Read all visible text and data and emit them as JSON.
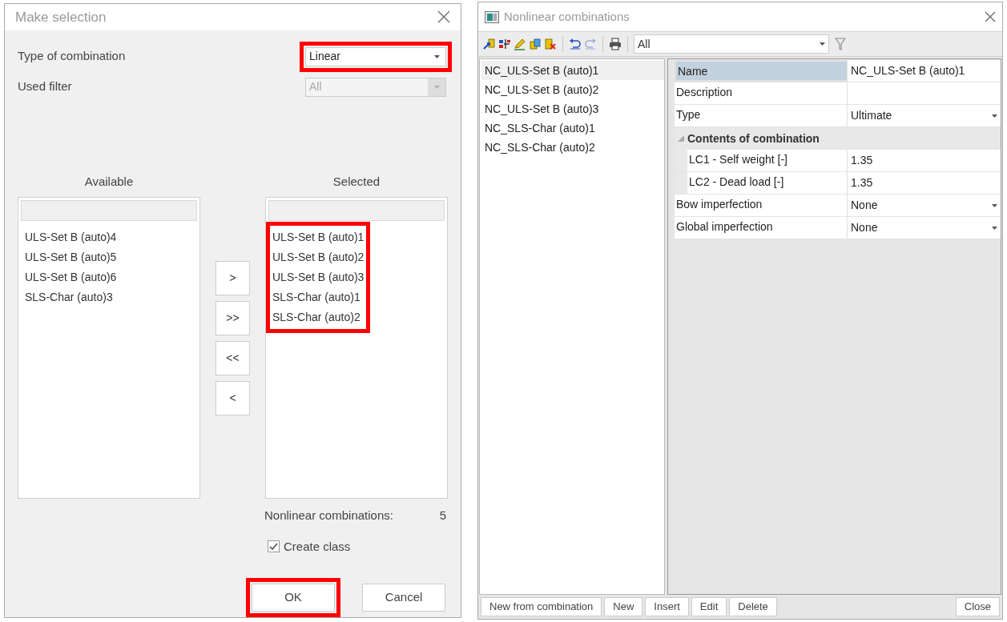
{
  "make_selection": {
    "title": "Make selection",
    "fields": [
      {
        "label": "Type of combination",
        "value": "Linear",
        "disabled": false,
        "highlighted": true
      },
      {
        "label": "Used filter",
        "value": "All",
        "disabled": true,
        "highlighted": false
      }
    ],
    "available": {
      "heading": "Available",
      "items": [
        "ULS-Set B (auto)4",
        "ULS-Set B (auto)5",
        "ULS-Set B (auto)6",
        "SLS-Char (auto)3"
      ],
      "highlighted": false
    },
    "move_buttons": [
      ">",
      ">>",
      "<<",
      "<"
    ],
    "selected": {
      "heading": "Selected",
      "items": [
        "ULS-Set B (auto)1",
        "ULS-Set B (auto)2",
        "ULS-Set B (auto)3",
        "SLS-Char (auto)1",
        "SLS-Char (auto)2"
      ],
      "highlighted": true
    },
    "count": {
      "label": "Nonlinear combinations:",
      "value": "5"
    },
    "create_class": {
      "label": "Create class",
      "checked": true
    },
    "buttons": [
      {
        "label": "OK",
        "highlighted": true
      },
      {
        "label": "Cancel",
        "highlighted": false
      }
    ]
  },
  "nonlinear": {
    "title": "Nonlinear combinations",
    "filter": {
      "value": "All"
    },
    "list": [
      {
        "label": "NC_ULS-Set B (auto)1",
        "selected": true
      },
      {
        "label": "NC_ULS-Set B (auto)2",
        "selected": false
      },
      {
        "label": "NC_ULS-Set B (auto)3",
        "selected": false
      },
      {
        "label": "NC_SLS-Char (auto)1",
        "selected": false
      },
      {
        "label": "NC_SLS-Char (auto)2",
        "selected": false
      }
    ],
    "properties": [
      {
        "kind": "row",
        "label": "Name",
        "value": "NC_ULS-Set B (auto)1",
        "dropdown": false,
        "selected": true
      },
      {
        "kind": "row",
        "label": "Description",
        "dropdown": false,
        "selected": false
      },
      {
        "kind": "row",
        "label": "Type",
        "value": "Ultimate",
        "dropdown": true,
        "selected": false
      },
      {
        "kind": "group",
        "label": "Contents of combination",
        "expanded": true,
        "children": [
          {
            "kind": "row",
            "label": "LC1 - Self weight [-]",
            "value": "1.35",
            "dropdown": false,
            "selected": false
          },
          {
            "kind": "row",
            "label": "LC2 - Dead load [-]",
            "value": "1.35",
            "dropdown": false,
            "selected": false
          }
        ]
      },
      {
        "kind": "row",
        "label": "Bow imperfection",
        "value": "None",
        "dropdown": true,
        "selected": false
      },
      {
        "kind": "row",
        "label": "Global imperfection",
        "value": "None",
        "dropdown": true,
        "selected": false
      }
    ],
    "buttons": [
      "New from combination",
      "New",
      "Insert",
      "Edit",
      "Delete"
    ],
    "close_button": "Close"
  }
}
